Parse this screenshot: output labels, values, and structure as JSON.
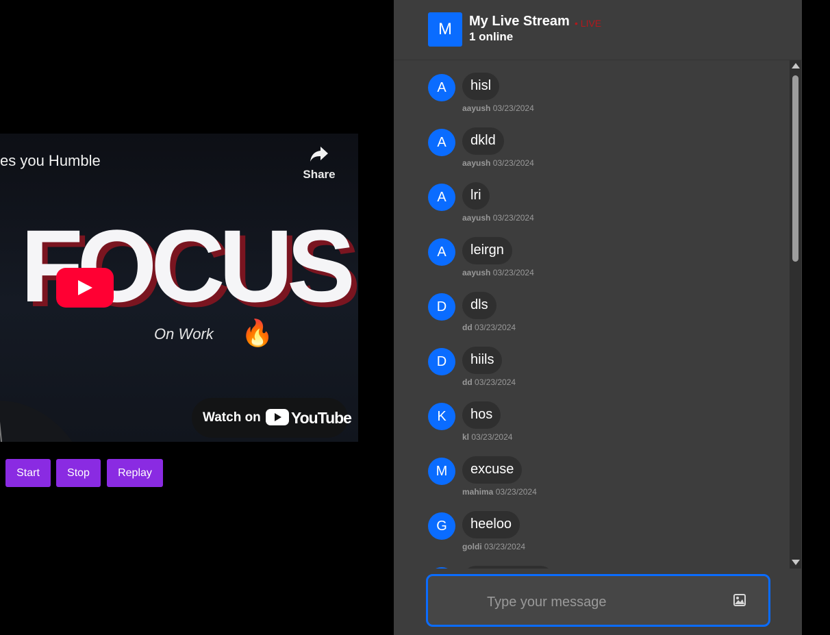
{
  "video": {
    "title": "es you Humble",
    "share_label": "Share",
    "headline": "FOCUS",
    "subline": "On Work",
    "emoji": "🔥",
    "watch_on_label": "Watch on",
    "youtube_word": "YouTube"
  },
  "controls": {
    "start_label": "Start",
    "stop_label": "Stop",
    "replay_label": "Replay"
  },
  "chat": {
    "header": {
      "avatar_letter": "M",
      "title": "My Live Stream",
      "live_label": "• LIVE",
      "online": "1 online"
    },
    "messages": [
      {
        "avatar": "A",
        "text": "hisl",
        "user": "aayush",
        "date": "03/23/2024"
      },
      {
        "avatar": "A",
        "text": "dkld",
        "user": "aayush",
        "date": "03/23/2024"
      },
      {
        "avatar": "A",
        "text": "lri",
        "user": "aayush",
        "date": "03/23/2024"
      },
      {
        "avatar": "A",
        "text": "leirgn",
        "user": "aayush",
        "date": "03/23/2024"
      },
      {
        "avatar": "D",
        "text": "dls",
        "user": "dd",
        "date": "03/23/2024"
      },
      {
        "avatar": "D",
        "text": "hiils",
        "user": "dd",
        "date": "03/23/2024"
      },
      {
        "avatar": "K",
        "text": "hos",
        "user": "kl",
        "date": "03/23/2024"
      },
      {
        "avatar": "M",
        "text": "excuse",
        "user": "mahima",
        "date": "03/23/2024"
      },
      {
        "avatar": "G",
        "text": "heeloo",
        "user": "goldi",
        "date": "03/23/2024"
      },
      {
        "avatar": "",
        "text": "",
        "user": "",
        "date": ""
      }
    ],
    "input_placeholder": "Type your message"
  },
  "colors": {
    "accent_blue": "#0a6cff",
    "button_purple": "#8a2be2",
    "live_red": "#b3181c",
    "youtube_red": "#ff0033",
    "panel_bg": "#3d3d3d"
  }
}
